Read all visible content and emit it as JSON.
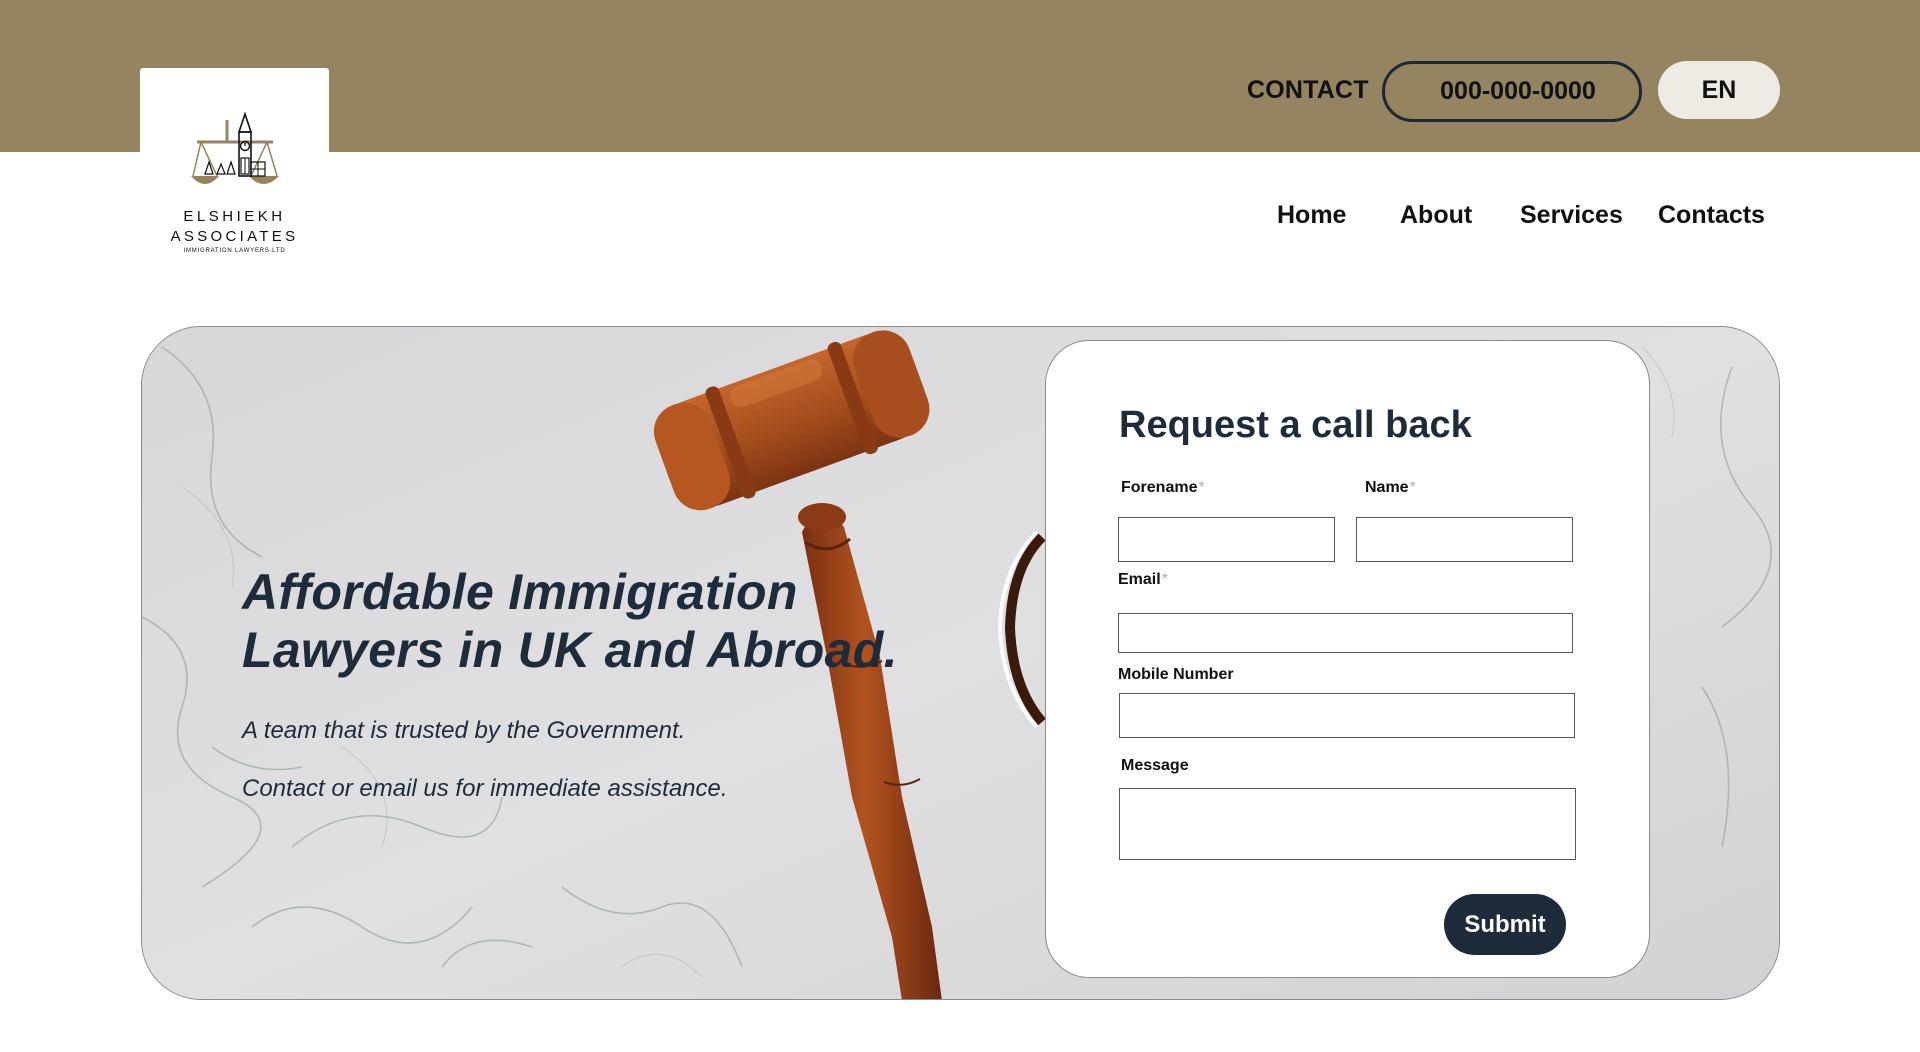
{
  "header": {
    "contact_label": "CONTACT",
    "phone": "000-000-0000",
    "language": "EN",
    "bar_color": "#94845f"
  },
  "logo": {
    "name_line1": "ELSHIEKH",
    "name_line2": "ASSOCIATES",
    "tagline": "IMMIGRATION LAWYERS LTD"
  },
  "nav": {
    "items": [
      {
        "label": "Home"
      },
      {
        "label": "About"
      },
      {
        "label": "Services"
      },
      {
        "label": "Contacts"
      }
    ]
  },
  "hero": {
    "title": "Affordable Immigration Lawyers in UK and Abroad.",
    "subtitle1": "A team that is trusted by the Government.",
    "subtitle2": "Contact or email us for immediate assistance."
  },
  "form": {
    "title": "Request a call back",
    "forename_label": "Forename",
    "name_label": "Name",
    "email_label": "Email",
    "mobile_label": "Mobile Number",
    "message_label": "Message",
    "required_mark": "*",
    "submit_label": "Submit"
  },
  "colors": {
    "accent_dark": "#1d2b3b",
    "gold": "#94845f"
  }
}
